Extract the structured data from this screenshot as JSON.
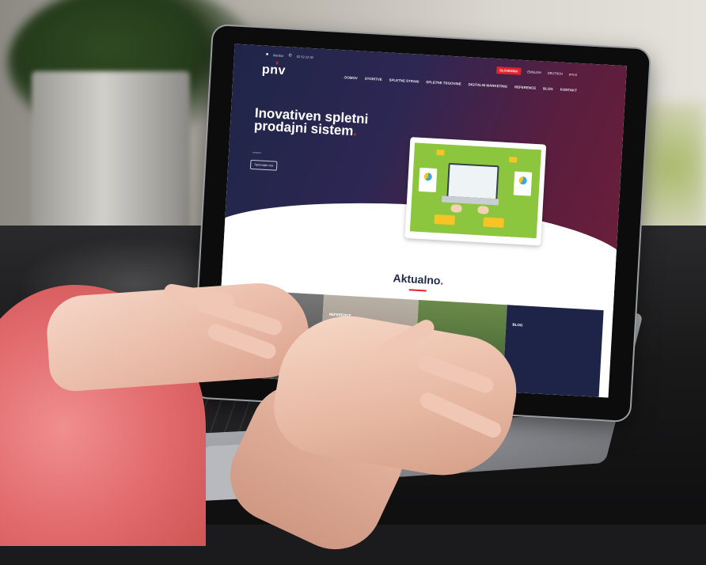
{
  "screen": {
    "topbar": {
      "location": "Maribor",
      "phone": "02 52 22 00"
    },
    "logo": "pnv",
    "languages": [
      {
        "label": "SLOVENSKI",
        "highlight": true
      },
      {
        "label": "ENGLISH",
        "highlight": false
      },
      {
        "label": "DEUTSCH",
        "highlight": false
      },
      {
        "label": "pnv.si",
        "highlight": false
      }
    ],
    "nav": [
      "DOMOV",
      "STORITVE",
      "SPLETNE STRANI",
      "SPLETNE TRGOVINE",
      "DIGITALNI MARKETING",
      "REFERENCE",
      "BLOG",
      "KONTAKT"
    ],
    "headline": "Inovativen spletni prodajni sistem",
    "cta_label": "Spoznajte nas",
    "section_title": "Aktualno",
    "tiles": [
      {
        "label": ""
      },
      {
        "label": "REFERENCE"
      },
      {
        "label": ""
      },
      {
        "label": "BLOG"
      }
    ]
  },
  "colors": {
    "accent": "#e3232d",
    "hero_start": "#1f2548",
    "hero_end": "#6a1f3a",
    "illustration_green": "#8cc63f"
  }
}
